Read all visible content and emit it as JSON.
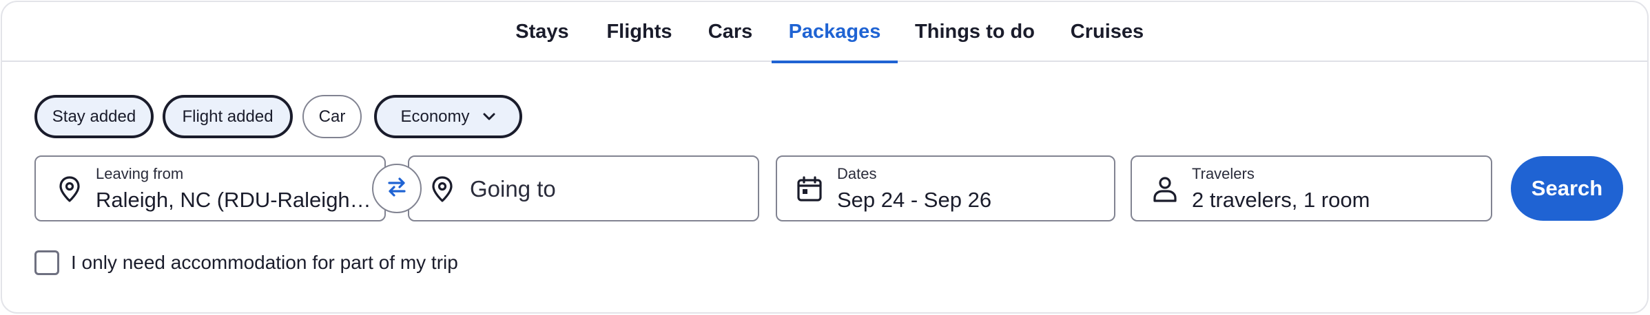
{
  "tabs": [
    {
      "label": "Stays"
    },
    {
      "label": "Flights"
    },
    {
      "label": "Cars"
    },
    {
      "label": "Packages",
      "active": true
    },
    {
      "label": "Things to do"
    },
    {
      "label": "Cruises"
    }
  ],
  "chips": {
    "stay": "Stay added",
    "flight": "Flight added",
    "car": "Car",
    "cabin_class": "Economy"
  },
  "fields": {
    "origin": {
      "label": "Leaving from",
      "value": "Raleigh, NC (RDU-Raleigh-Durham Intl.)"
    },
    "destination": {
      "placeholder": "Going to"
    },
    "dates": {
      "label": "Dates",
      "value": "Sep 24 - Sep 26"
    },
    "travelers": {
      "label": "Travelers",
      "value": "2 travelers, 1 room"
    }
  },
  "search_button": "Search",
  "partial_stay": {
    "label": "I only need accommodation for part of my trip",
    "checked": false
  },
  "colors": {
    "accent": "#1f63d3",
    "text": "#1a1c2b",
    "border": "#818391",
    "chip_selected_bg": "#ebf1fb"
  },
  "icons": [
    "map-pin-icon",
    "swap-arrows-icon",
    "calendar-icon",
    "person-icon",
    "chevron-down-icon"
  ]
}
